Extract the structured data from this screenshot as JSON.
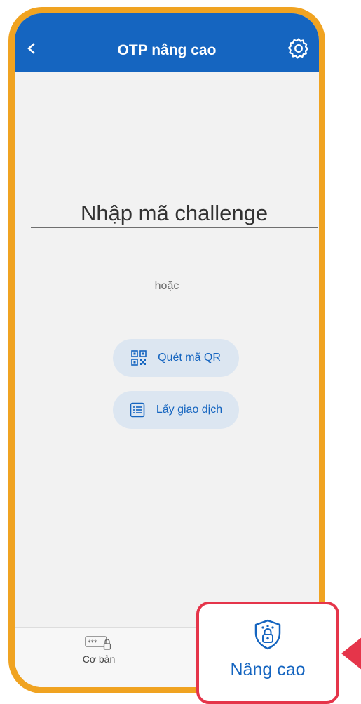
{
  "header": {
    "title": "OTP nâng cao",
    "back_icon": "chevron-left-icon",
    "settings_icon": "gear-icon"
  },
  "challenge": {
    "placeholder": "Nhập mã challenge",
    "value": ""
  },
  "divider_text": "hoặc",
  "actions": {
    "scan_qr": {
      "label": "Quét mã QR",
      "icon": "qr-code-icon"
    },
    "get_transaction": {
      "label": "Lấy giao dịch",
      "icon": "list-icon"
    }
  },
  "bottom_nav": {
    "basic": {
      "label": "Cơ bản",
      "icon": "password-lock-icon"
    },
    "advanced": {
      "label": "Nâng cao",
      "icon": "shield-lock-icon",
      "active": true
    }
  },
  "colors": {
    "primary": "#1565C0",
    "frame": "#F0A321",
    "highlight": "#E5354A",
    "pill_bg": "#DCE6F1"
  }
}
